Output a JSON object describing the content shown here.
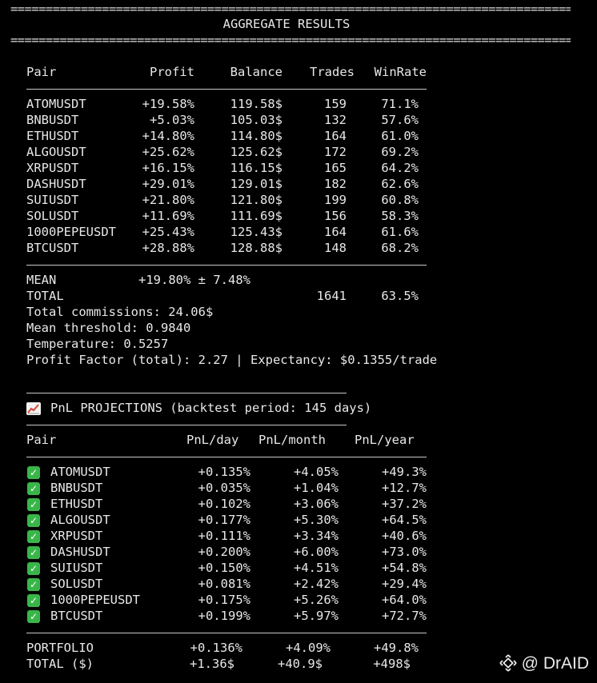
{
  "title": "AGGREGATE RESULTS",
  "divider": "================================================================================",
  "agg_headers": [
    "Pair",
    "Profit",
    "Balance",
    "Trades",
    "WinRate"
  ],
  "agg_rows": [
    {
      "pair": "ATOMUSDT",
      "profit": "+19.58%",
      "balance": "119.58$",
      "trades": "159",
      "winrate": "71.1%"
    },
    {
      "pair": "BNBUSDT",
      "profit": "+5.03%",
      "balance": "105.03$",
      "trades": "132",
      "winrate": "57.6%"
    },
    {
      "pair": "ETHUSDT",
      "profit": "+14.80%",
      "balance": "114.80$",
      "trades": "164",
      "winrate": "61.0%"
    },
    {
      "pair": "ALGOUSDT",
      "profit": "+25.62%",
      "balance": "125.62$",
      "trades": "172",
      "winrate": "69.2%"
    },
    {
      "pair": "XRPUSDT",
      "profit": "+16.15%",
      "balance": "116.15$",
      "trades": "165",
      "winrate": "64.2%"
    },
    {
      "pair": "DASHUSDT",
      "profit": "+29.01%",
      "balance": "129.01$",
      "trades": "182",
      "winrate": "62.6%"
    },
    {
      "pair": "SUIUSDT",
      "profit": "+21.80%",
      "balance": "121.80$",
      "trades": "199",
      "winrate": "60.8%"
    },
    {
      "pair": "SOLUSDT",
      "profit": "+11.69%",
      "balance": "111.69$",
      "trades": "156",
      "winrate": "58.3%"
    },
    {
      "pair": "1000PEPEUSDT",
      "profit": "+25.43%",
      "balance": "125.43$",
      "trades": "164",
      "winrate": "61.6%"
    },
    {
      "pair": "BTCUSDT",
      "profit": "+28.88%",
      "balance": "128.88$",
      "trades": "148",
      "winrate": "68.2%"
    }
  ],
  "mean": {
    "label": "MEAN",
    "value": "+19.80% ± 7.48%"
  },
  "total": {
    "label": "TOTAL",
    "trades": "1641",
    "winrate": "63.5%"
  },
  "info_lines": [
    "Total commissions: 24.06$",
    "Mean threshold: 0.9840",
    "Temperature: 0.5257",
    "Profit Factor (total): 2.27 | Expectancy: $0.1355/trade"
  ],
  "proj_title": "PnL PROJECTIONS (backtest period: 145 days)",
  "proj_icon": "chart-increasing-icon",
  "proj_headers": [
    "Pair",
    "PnL/day",
    "PnL/month",
    "PnL/year"
  ],
  "proj_rows": [
    {
      "pair": "ATOMUSDT",
      "day": "+0.135%",
      "month": "+4.05%",
      "year": "+49.3%"
    },
    {
      "pair": "BNBUSDT",
      "day": "+0.035%",
      "month": "+1.04%",
      "year": "+12.7%"
    },
    {
      "pair": "ETHUSDT",
      "day": "+0.102%",
      "month": "+3.06%",
      "year": "+37.2%"
    },
    {
      "pair": "ALGOUSDT",
      "day": "+0.177%",
      "month": "+5.30%",
      "year": "+64.5%"
    },
    {
      "pair": "XRPUSDT",
      "day": "+0.111%",
      "month": "+3.34%",
      "year": "+40.6%"
    },
    {
      "pair": "DASHUSDT",
      "day": "+0.200%",
      "month": "+6.00%",
      "year": "+73.0%"
    },
    {
      "pair": "SUIUSDT",
      "day": "+0.150%",
      "month": "+4.51%",
      "year": "+54.8%"
    },
    {
      "pair": "SOLUSDT",
      "day": "+0.081%",
      "month": "+2.42%",
      "year": "+29.4%"
    },
    {
      "pair": "1000PEPEUSDT",
      "day": "+0.175%",
      "month": "+5.26%",
      "year": "+64.0%"
    },
    {
      "pair": "BTCUSDT",
      "day": "+0.199%",
      "month": "+5.97%",
      "year": "+72.7%"
    }
  ],
  "portfolio": {
    "label": "PORTFOLIO",
    "day": "+0.136%",
    "month": "+4.09%",
    "year": "+49.8%"
  },
  "total_usd": {
    "label": "TOTAL ($)",
    "day": "+1.36$",
    "month": "+40.9$",
    "year": "+498$"
  },
  "watermark": "@ DrAID",
  "colors": {
    "background": "#000000",
    "text": "#e8e8e8",
    "check": "#3bb54a"
  }
}
